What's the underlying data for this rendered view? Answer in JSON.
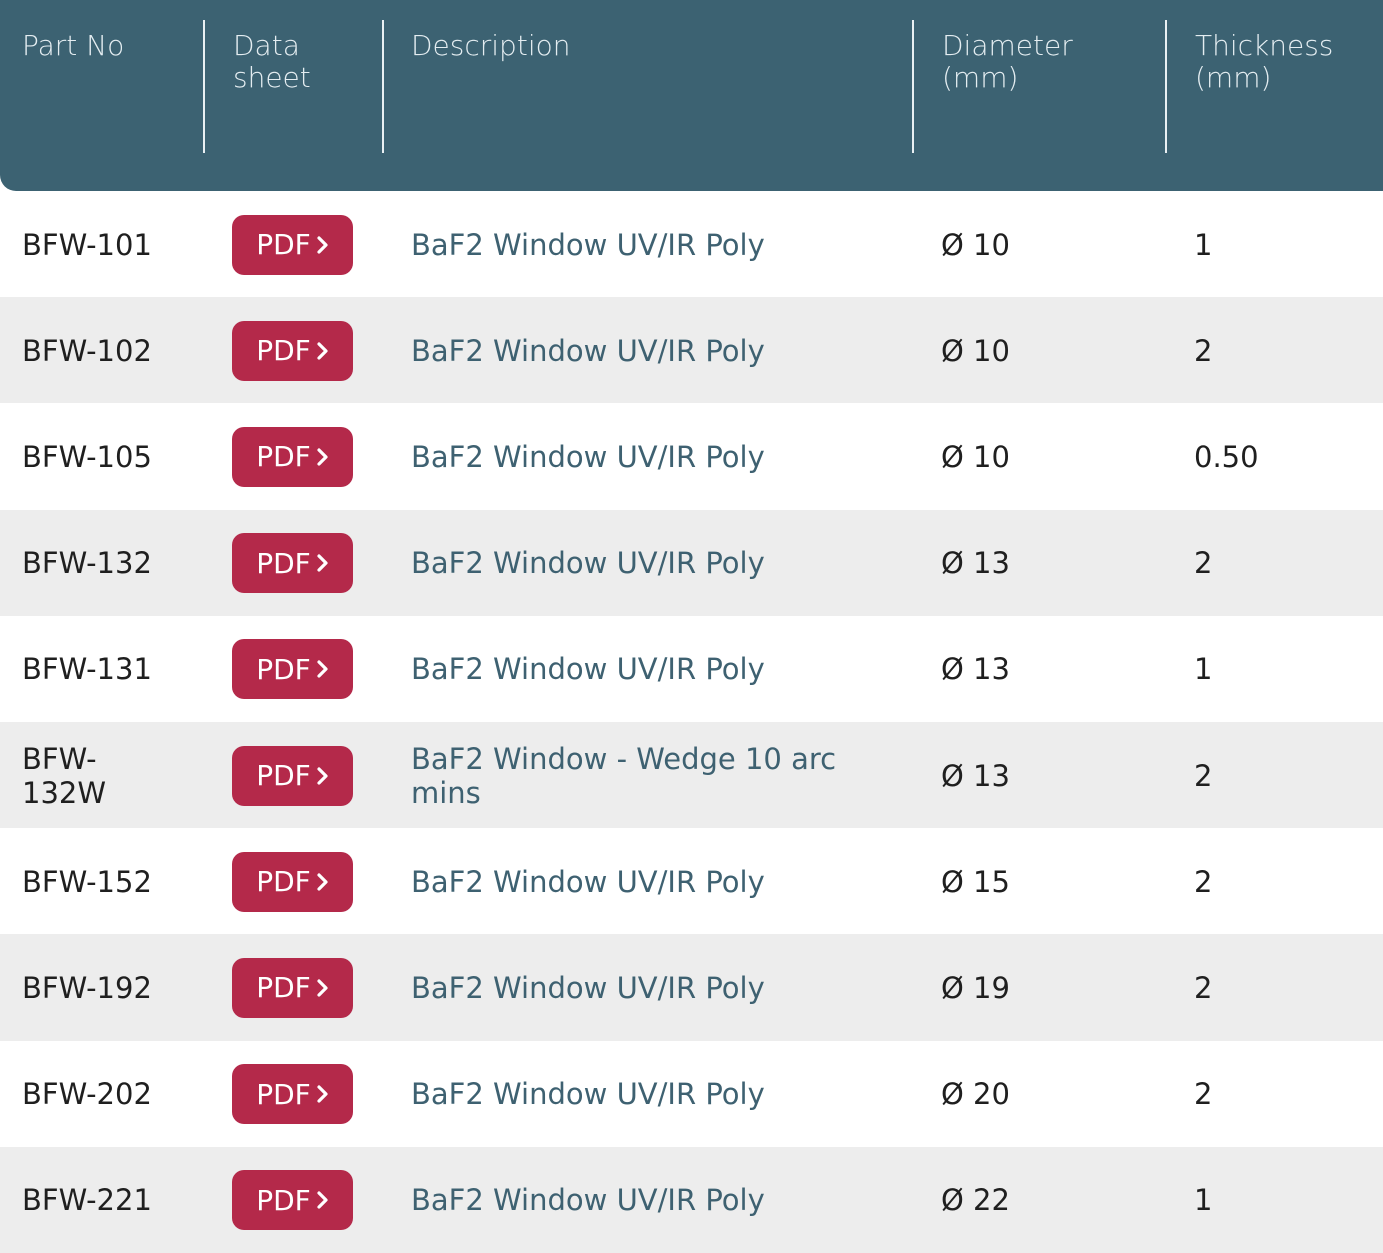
{
  "colors": {
    "header_bg": "#3c6272",
    "row_alt_bg": "#ededed",
    "pdf_button_bg": "#b4294a",
    "description_text": "#3e6171"
  },
  "header": {
    "part_no": "Part No",
    "data_sheet_line1": "Data",
    "data_sheet_line2": "sheet",
    "description": "Description",
    "diameter_line1": "Diameter",
    "diameter_line2": "(mm)",
    "thickness_line1": "Thickness",
    "thickness_line2": "(mm)"
  },
  "pdf_label": "PDF",
  "pdf_icon": "chevron-right-icon",
  "rows": [
    {
      "part_no": "BFW-101",
      "description": "BaF2 Window UV/IR Poly",
      "diameter": "Ø 10",
      "thickness": "1"
    },
    {
      "part_no": "BFW-102",
      "description": "BaF2 Window UV/IR Poly",
      "diameter": "Ø 10",
      "thickness": "2"
    },
    {
      "part_no": "BFW-105",
      "description": "BaF2 Window UV/IR Poly",
      "diameter": "Ø 10",
      "thickness": "0.50"
    },
    {
      "part_no": "BFW-132",
      "description": "BaF2 Window UV/IR Poly",
      "diameter": "Ø 13",
      "thickness": "2"
    },
    {
      "part_no": "BFW-131",
      "description": "BaF2 Window UV/IR Poly",
      "diameter": "Ø 13",
      "thickness": "1"
    },
    {
      "part_no": "BFW-132W",
      "description": "BaF2 Window - Wedge 10 arc mins",
      "diameter": "Ø 13",
      "thickness": "2"
    },
    {
      "part_no": "BFW-152",
      "description": "BaF2 Window UV/IR Poly",
      "diameter": "Ø 15",
      "thickness": "2"
    },
    {
      "part_no": "BFW-192",
      "description": "BaF2 Window UV/IR Poly",
      "diameter": "Ø 19",
      "thickness": "2"
    },
    {
      "part_no": "BFW-202",
      "description": "BaF2 Window UV/IR Poly",
      "diameter": "Ø 20",
      "thickness": "2"
    },
    {
      "part_no": "BFW-221",
      "description": "BaF2 Window UV/IR Poly",
      "diameter": "Ø 22",
      "thickness": "1"
    }
  ]
}
